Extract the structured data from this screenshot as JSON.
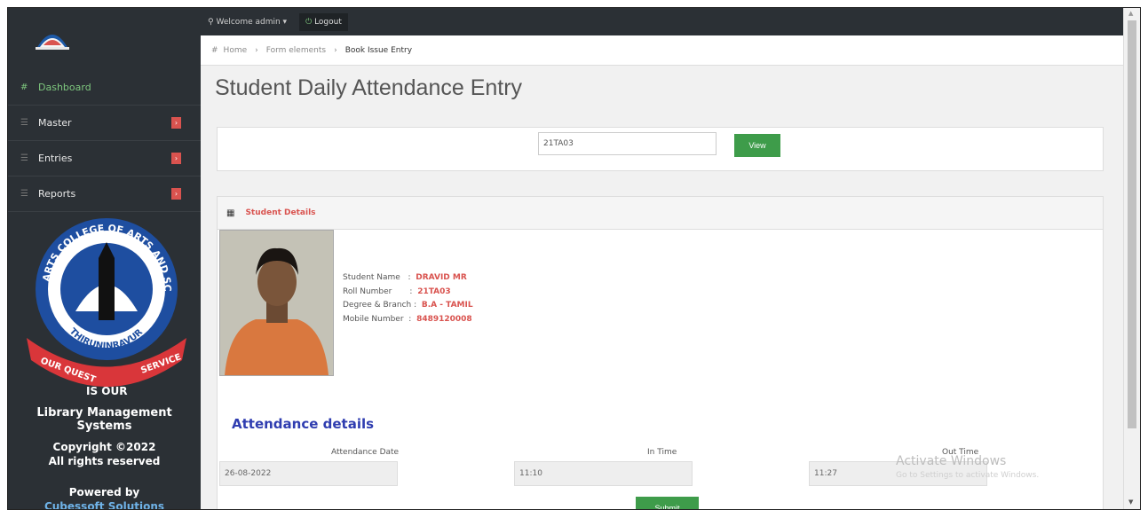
{
  "sidebar": {
    "items": [
      {
        "icon": "dashboard-icon",
        "label": "Dashboard"
      },
      {
        "icon": "list-icon",
        "label": "Master"
      },
      {
        "icon": "list-icon",
        "label": "Entries"
      },
      {
        "icon": "list-icon",
        "label": "Reports"
      }
    ],
    "seal_text_top": "ARTS COLLEGE OF ARTS AND SCIENCE",
    "seal_text_mid": "THIRUNINRAVUR",
    "seal_ribbon_left": "OUR QUEST",
    "seal_ribbon_right": "SERVICE",
    "seal_ribbon_bottom": "IS OUR",
    "app_title": "Library Management Systems",
    "copyright_line1": "Copyright ©2022",
    "copyright_line2": "All rights reserved",
    "powered_by": "Powered by",
    "company": "Cubessoft Solutions"
  },
  "topbar": {
    "welcome": "Welcome admin",
    "logout": "Logout"
  },
  "breadcrumb": {
    "home": "Home",
    "section": "Form elements",
    "current": "Book Issue Entry"
  },
  "page": {
    "title": "Student Daily Attendance Entry"
  },
  "search": {
    "roll_value": "21TA03",
    "view_label": "View"
  },
  "student_panel": {
    "header": "Student Details",
    "fields": [
      {
        "label": "Student Name",
        "sep": ":",
        "value": "DRAVID MR"
      },
      {
        "label": "Roll Number",
        "sep": ":",
        "value": "21TA03"
      },
      {
        "label": "Degree & Branch",
        "sep": ":",
        "value": "B.A - TAMIL"
      },
      {
        "label": "Mobile Number",
        "sep": ":",
        "value": "8489120008"
      }
    ]
  },
  "attendance": {
    "title": "Attendance details",
    "date_label": "Attendance Date",
    "date_value": "26-08-2022",
    "in_label": "In Time",
    "in_value": "11:10",
    "out_label": "Out Time",
    "out_value": "11:27",
    "submit_label": "Submit"
  },
  "watermark": {
    "line1": "Activate Windows",
    "line2": "Go to Settings to activate Windows."
  },
  "colors": {
    "sidebar_bg": "#2b3035",
    "accent_green": "#3e9c4a",
    "accent_red": "#d9534f",
    "heading_blue": "#2f3db0"
  }
}
